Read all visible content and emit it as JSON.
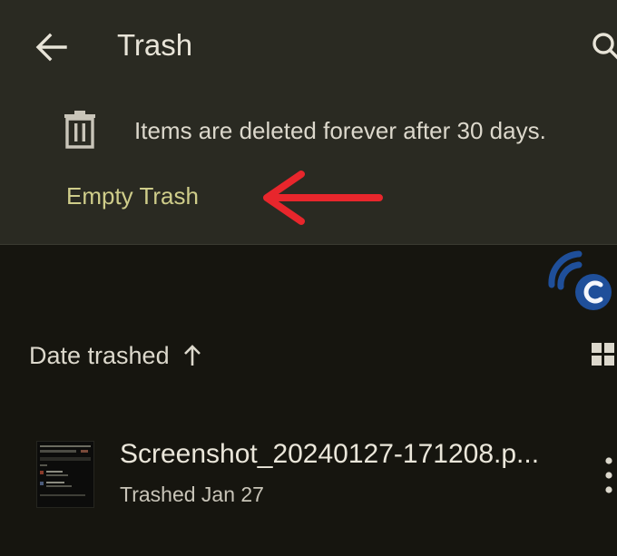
{
  "header": {
    "title": "Trash",
    "back_icon": "arrow-left-icon",
    "search_icon": "search-icon"
  },
  "banner": {
    "icon": "trash-can-icon",
    "message": "Items are deleted forever after 30 days.",
    "action_label": "Empty Trash",
    "action_color": "#cfcd8a"
  },
  "annotation": {
    "icon": "red-arrow-left-icon",
    "color": "#e8262c"
  },
  "watermark": {
    "icon": "c-logo-watermark-icon",
    "color": "#1f4f9a"
  },
  "sort": {
    "label": "Date trashed",
    "direction_icon": "arrow-up-icon",
    "view_icon": "grid-view-icon"
  },
  "files": [
    {
      "name": "Screenshot_20240127-171208.p...",
      "meta": "Trashed Jan 27",
      "thumbnail_icon": "screenshot-thumbnail-icon",
      "more_icon": "more-vertical-icon"
    }
  ],
  "colors": {
    "panel_bg": "#2a2a22",
    "page_bg": "#16150f",
    "text_primary": "#e8e4d8"
  }
}
